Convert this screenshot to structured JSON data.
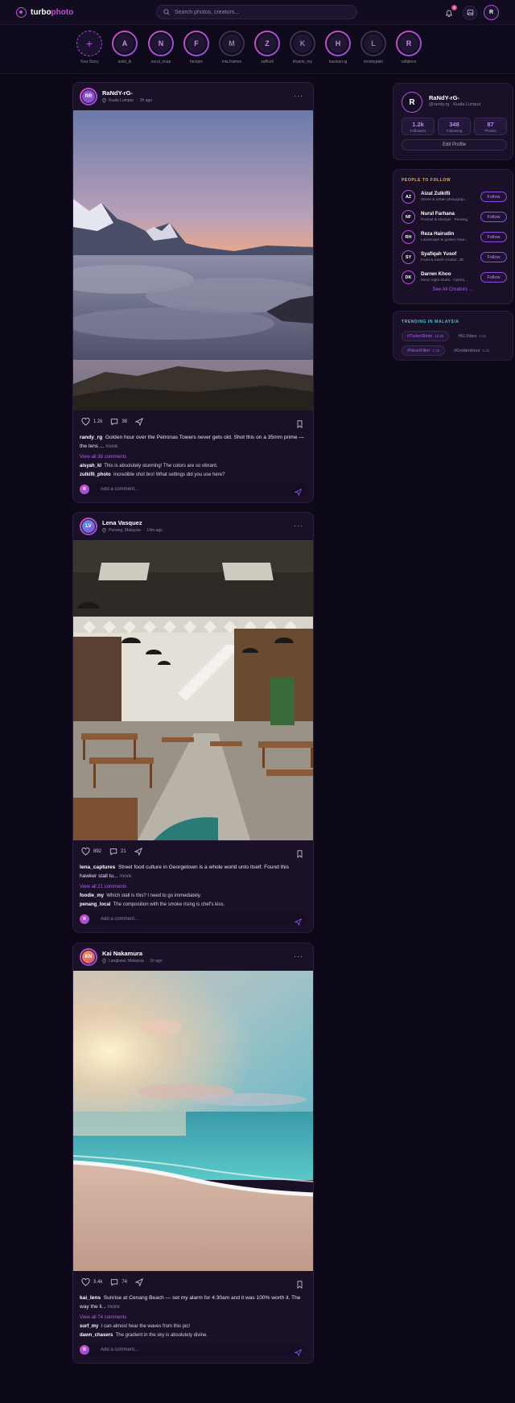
{
  "app": {
    "brand_main": "turbo",
    "brand_accent": "photo",
    "search_placeholder": "Search photos, creators...",
    "notif_count": "3",
    "user_initial": "R",
    "accent": "#c04fd8"
  },
  "stories": [
    {
      "name": "Your Story",
      "initial": "+",
      "type": "add"
    },
    {
      "name": "aviid_kl",
      "initial": "A",
      "type": "new"
    },
    {
      "name": "nurul_snap",
      "initial": "N",
      "type": "new"
    },
    {
      "name": "farizpix",
      "initial": "F",
      "type": "new"
    },
    {
      "name": "mia.frames",
      "initial": "M",
      "type": "seen"
    },
    {
      "name": "zaffcell",
      "initial": "Z",
      "type": "new"
    },
    {
      "name": "khairie_my",
      "initial": "K",
      "type": "seen"
    },
    {
      "name": "hazwan.ig",
      "initial": "H",
      "type": "new"
    },
    {
      "name": "lensbypaki",
      "initial": "L",
      "type": "seen"
    },
    {
      "name": "rafiqlens",
      "initial": "R",
      "type": "new"
    }
  ],
  "posts": [
    {
      "user": "RaNdY-rG-",
      "avatar": "RR",
      "location": "Kuala Lumpur",
      "time": "2h ago",
      "likes": "1.2k",
      "comments": "38",
      "caption_user": "randy_rg",
      "caption": "Golden hour over the Petronas Towers never gets old. Shot this on a 35mm prime — the lens ...",
      "more": "more",
      "view_all": "View all 38 comments",
      "c1_user": "aisyah_kl",
      "c1_text": "This is absolutely stunning! The colors are so vibrant.",
      "c2_user": "zulkifli_photo",
      "c2_text": "Incredible shot bro! What settings did you use here?",
      "add_placeholder": "Add a comment..."
    },
    {
      "user": "Lena Vasquez",
      "avatar": "LV",
      "location": "Penang, Malaysia",
      "time": "14m ago",
      "likes": "892",
      "comments": "21",
      "caption_user": "lena_captures",
      "caption": "Street food culture in Georgetown is a whole world unto itself. Found this hawker stall tu...",
      "more": "more",
      "view_all": "View all 21 comments",
      "c1_user": "foodie_my",
      "c1_text": "Which stall is this? I need to go immediately.",
      "c2_user": "penang_local",
      "c2_text": "The composition with the smoke rising is chef's kiss.",
      "add_placeholder": "Add a comment..."
    },
    {
      "user": "Kai Nakamura",
      "avatar": "KN",
      "location": "Langkawi, Malaysia",
      "time": "1h ago",
      "likes": "3.4k",
      "comments": "74",
      "caption_user": "kai_lens",
      "caption": "Sunrise at Cenang Beach — set my alarm for 4:30am and it was 100% worth it. The way the li...",
      "more": "more",
      "view_all": "View all 74 comments",
      "c1_user": "surf_my",
      "c1_text": "I can almost hear the waves from this pic!",
      "c2_user": "dawn_chasers",
      "c2_text": "The gradient in the sky is absolutely divine.",
      "add_placeholder": "Add a comment..."
    }
  ],
  "profile": {
    "initial": "R",
    "name": "RaNdY-rG-",
    "handle": "@randy.rg · Kuala Lumpur",
    "followers": "1.2k",
    "followers_label": "Followers",
    "following": "348",
    "following_label": "Following",
    "photos": "87",
    "photos_label": "Photos",
    "edit": "Edit Profile"
  },
  "people": {
    "title": "PEOPLE TO FOLLOW",
    "title_color": "#f0b23c",
    "follow_label": "Follow",
    "see_all": "See All Creators →",
    "items": [
      {
        "initials": "AZ",
        "name": "Aizat Zulkifli",
        "desc": "Street & urban photograp..."
      },
      {
        "initials": "NF",
        "name": "Nurul Farhana",
        "desc": "Portrait & lifestyle · Penang"
      },
      {
        "initials": "RH",
        "name": "Reza Hairudin",
        "desc": "Landscape & golden hour..."
      },
      {
        "initials": "SY",
        "name": "Syafiqah Yusof",
        "desc": "Food & travel creator, JB"
      },
      {
        "initials": "DK",
        "name": "Darren Khoo",
        "desc": "Neon night shots · Cyberj..."
      }
    ]
  },
  "trending": {
    "title": "TRENDING IN MALAYSIA",
    "title_color": "#3ccfd8",
    "tags": [
      {
        "tag": "#TurboShots",
        "count": "14.2k",
        "hl": true
      },
      {
        "tag": "#KLVibes",
        "count": "9.8k",
        "hl": false
      },
      {
        "tag": "#NeonFilter",
        "count": "7.1k",
        "hl": true
      },
      {
        "tag": "#GoldenHour",
        "count": "6.2k",
        "hl": false
      }
    ]
  }
}
